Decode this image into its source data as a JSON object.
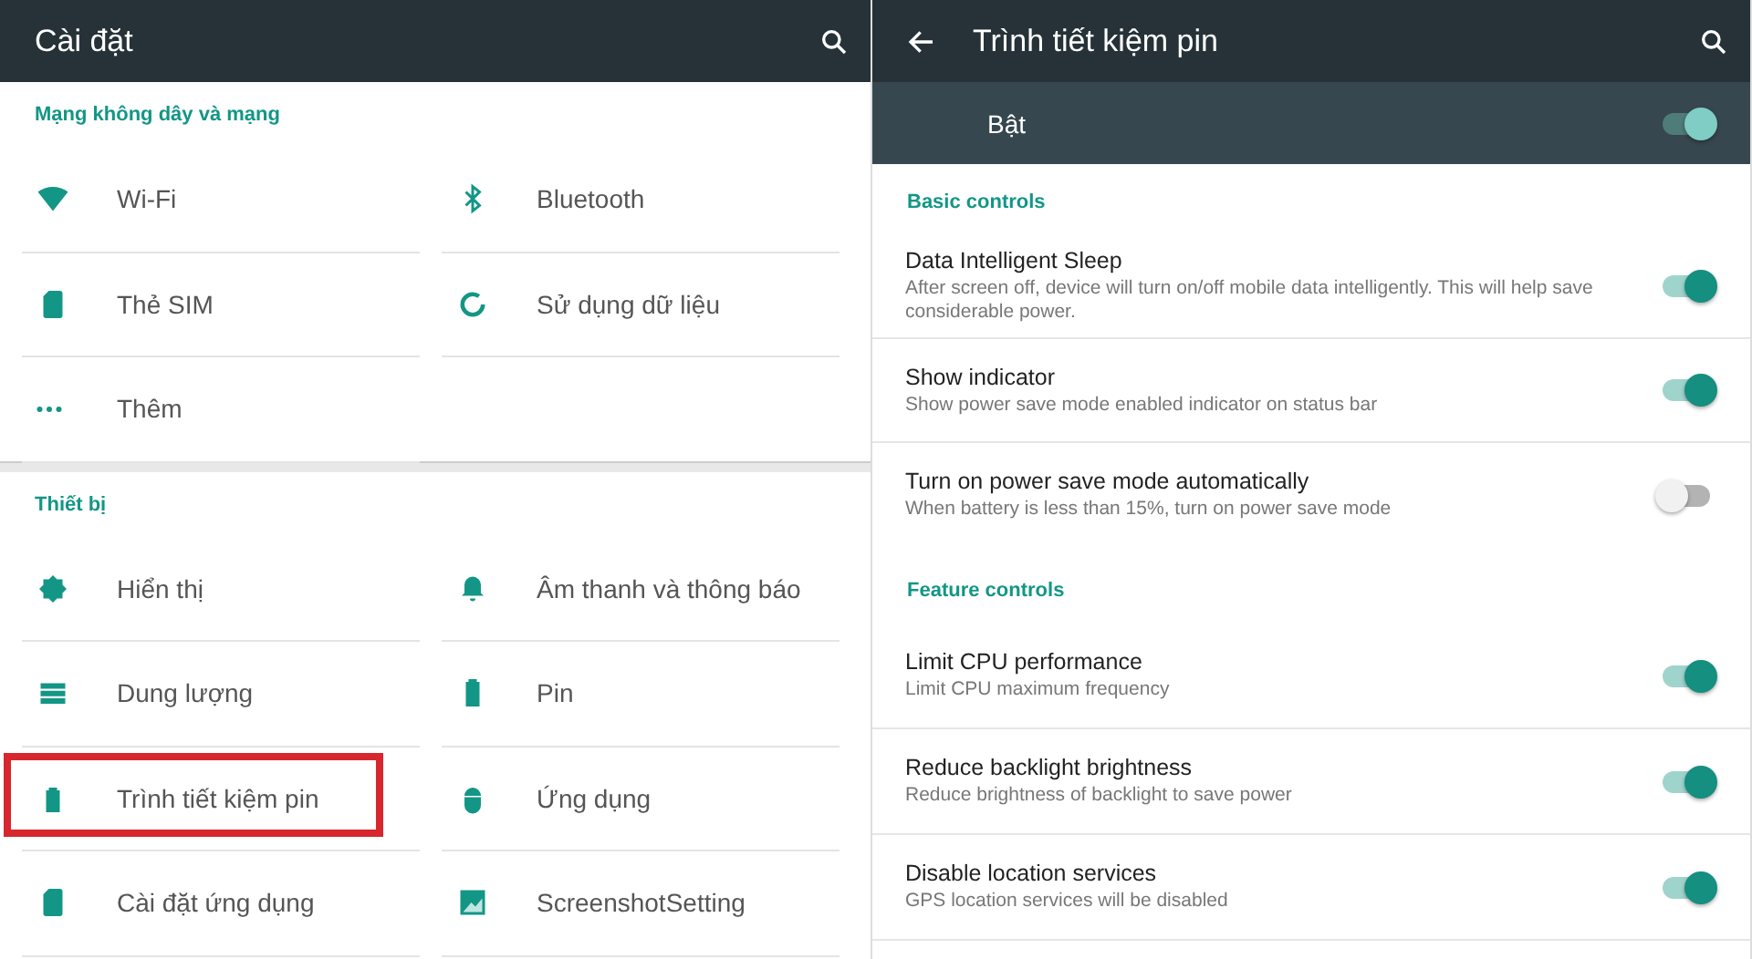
{
  "settings": {
    "title": "Cài đặt",
    "sections": [
      {
        "title": "Mạng không dây và mạng",
        "items": [
          {
            "label": "Wi-Fi",
            "highlighted": false
          },
          {
            "label": "Bluetooth",
            "highlighted": false
          },
          {
            "label": "Thẻ SIM",
            "highlighted": false
          },
          {
            "label": "Sử dụng dữ liệu",
            "highlighted": false
          },
          {
            "label": "Thêm",
            "highlighted": false
          }
        ]
      },
      {
        "title": "Thiết bị",
        "items": [
          {
            "label": "Hiển thị",
            "highlighted": false
          },
          {
            "label": "Âm thanh và thông báo",
            "highlighted": false
          },
          {
            "label": "Dung lượng",
            "highlighted": false
          },
          {
            "label": "Pin",
            "highlighted": false
          },
          {
            "label": "Trình tiết kiệm pin",
            "highlighted": true
          },
          {
            "label": "Ứng dụng",
            "highlighted": false
          },
          {
            "label": "Cài đặt ứng dụng",
            "highlighted": false
          },
          {
            "label": "ScreenshotSetting",
            "highlighted": false
          }
        ]
      }
    ]
  },
  "battery_saver": {
    "title": "Trình tiết kiệm pin",
    "master": {
      "label": "Bật",
      "on": true
    },
    "sections": [
      {
        "title": "Basic controls",
        "items": [
          {
            "title": "Data Intelligent Sleep",
            "description": "After screen off, device will turn on/off mobile data intelligently. This will help save considerable power.",
            "on": true
          },
          {
            "title": "Show indicator",
            "description": "Show power save mode enabled indicator on status bar",
            "on": true
          },
          {
            "title": "Turn on power save mode automatically",
            "description": "When battery is less than 15%, turn on power save mode",
            "on": false
          }
        ]
      },
      {
        "title": "Feature controls",
        "items": [
          {
            "title": "Limit CPU performance",
            "description": "Limit CPU maximum frequency",
            "on": true
          },
          {
            "title": "Reduce backlight brightness",
            "description": "Reduce brightness of backlight to save power",
            "on": true
          },
          {
            "title": "Disable location services",
            "description": "GPS location services will be disabled",
            "on": true
          }
        ]
      }
    ]
  }
}
